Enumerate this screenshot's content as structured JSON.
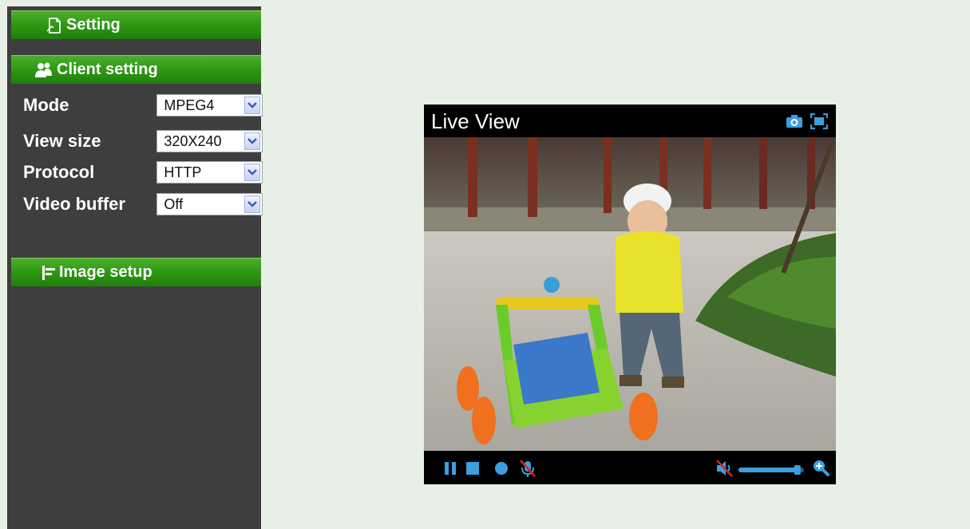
{
  "sidebar": {
    "setting_label": "Setting",
    "client_setting_label": "Client setting",
    "image_setup_label": "Image setup",
    "rows": [
      {
        "label": "Mode",
        "value": "MPEG4"
      },
      {
        "label": "View size",
        "value": "320X240"
      },
      {
        "label": "Protocol",
        "value": "HTTP"
      },
      {
        "label": "Video buffer",
        "value": "Off"
      }
    ]
  },
  "viewer": {
    "title": "Live View",
    "volume_level": 0.9
  },
  "colors": {
    "sidebar_bg": "#3e3e3e",
    "bar_green": "#2f9a14",
    "page_bg": "#e8efe6",
    "icon_blue": "#3aa0e0"
  },
  "icons": [
    "document-icon",
    "users-icon",
    "image-setup-icon",
    "camera-icon",
    "fullscreen-icon",
    "pause-icon",
    "stop-icon",
    "record-icon",
    "mic-muted-icon",
    "speaker-muted-icon",
    "zoom-icon"
  ]
}
